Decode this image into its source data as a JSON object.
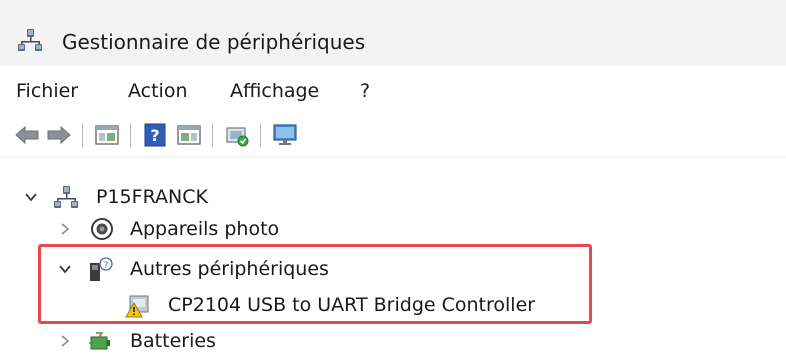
{
  "window": {
    "title": "Gestionnaire de périphériques",
    "title_icon": "device-manager-icon"
  },
  "menu": {
    "items": [
      "Fichier",
      "Action",
      "Affichage",
      "?"
    ]
  },
  "toolbar": {
    "buttons": [
      "back-arrow-icon",
      "forward-arrow-icon",
      "show-hide-console-tree-icon",
      "help-icon",
      "action-pane-icon",
      "scan-hardware-changes-icon",
      "monitor-display-icon"
    ]
  },
  "tree": {
    "root": {
      "label": "P15FRANCK",
      "expanded": true,
      "icon": "computer-icon"
    },
    "categories": [
      {
        "label": "Appareils photo",
        "expanded": false,
        "icon": "camera-icon"
      },
      {
        "label": "Autres périphériques",
        "expanded": true,
        "icon": "unknown-device-icon",
        "children": [
          {
            "label": "CP2104 USB to UART Bridge Controller",
            "icon": "warning-device-icon",
            "status": "warning"
          }
        ]
      },
      {
        "label": "Batteries",
        "expanded": false,
        "icon": "battery-icon"
      }
    ]
  },
  "colors": {
    "highlight_border": "#e5484d",
    "titlebar_bg": "#f3f3f3",
    "text": "#1a1a1a"
  }
}
